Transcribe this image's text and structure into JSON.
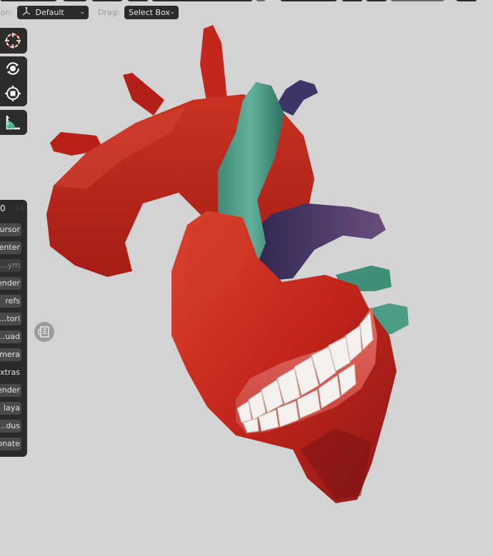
{
  "header": {
    "orientation_label": "ion:",
    "orientation_value": "Default",
    "drag_label": "Drag:",
    "drag_value": "Select Box"
  },
  "toolbar": {
    "tools": [
      "cursor-tool",
      "rotate-tool",
      "scale-tool",
      "measure-tool"
    ]
  },
  "side_panel": {
    "tab_number": "0",
    "buttons": [
      {
        "label": "ursor",
        "state": "normal"
      },
      {
        "label": "enter",
        "state": "normal"
      },
      {
        "label": "ym...",
        "state": "disabled"
      },
      {
        "label": "ender",
        "state": "normal"
      },
      {
        "label": "refs",
        "state": "normal"
      },
      {
        "label": "tori...",
        "state": "normal"
      },
      {
        "label": "uad...",
        "state": "normal"
      },
      {
        "label": "mera",
        "state": "normal"
      },
      {
        "label": "xtras",
        "state": "flat"
      },
      {
        "label": "ender",
        "state": "normal"
      },
      {
        "label": "laya",
        "state": "normal"
      },
      {
        "label": "dus...",
        "state": "normal"
      },
      {
        "label": "onate",
        "state": "normal"
      }
    ]
  },
  "colors": {
    "viewport_bg": "#d3d3d3",
    "heart_red": "#c0261c",
    "vessel_teal": "#4f9a85",
    "vein_purple": "#4a3a66",
    "panel_bg": "#2b2b2b"
  }
}
